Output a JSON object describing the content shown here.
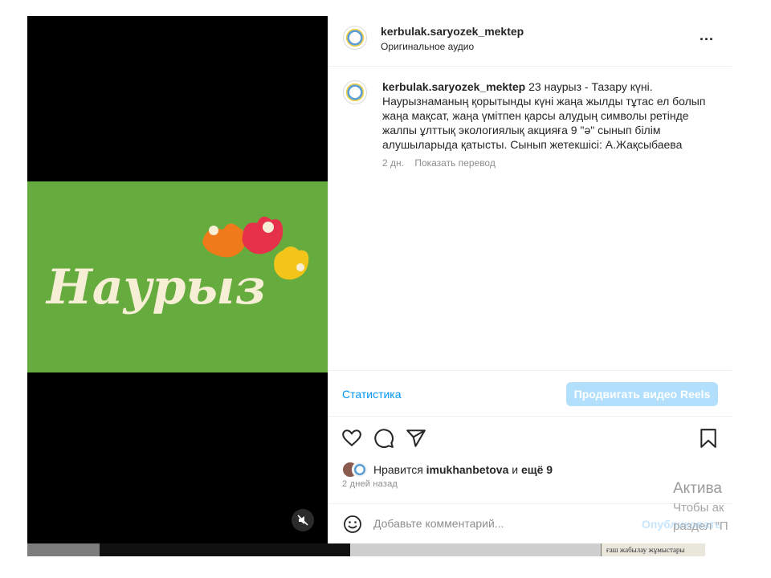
{
  "post": {
    "username": "kerbulak.saryozek_mektep",
    "audio_label": "Оригинальное аудио",
    "more_label": "...",
    "caption_user": "kerbulak.saryozek_mektep",
    "caption_text": "23 наурыз - Тазару күні. Наурызнаманың қорытынды күні жаңа жылды тұтас ел болып жаңа мақсат, жаңа үмітпен қарсы алудың символы ретінде жалпы ұлттық экологиялық акцияға 9 \"ә\" сынып білім алушыларыда қатысты. Сынып жетекшісі: А.Жақсыбаева",
    "caption_age": "2 дн.",
    "translate_label": "Показать перевод"
  },
  "video": {
    "banner_text": "Наурыз",
    "banner_color": "#66ab3e",
    "mute_icon": "speaker-muted-icon"
  },
  "insights": {
    "stats_label": "Статистика",
    "promote_label": "Продвигать видео Reels"
  },
  "actions": {
    "like_icon": "heart-icon",
    "comment_icon": "comment-icon",
    "share_icon": "send-icon",
    "save_icon": "bookmark-icon"
  },
  "likes": {
    "prefix": "Нравится",
    "user": "imukhanbetova",
    "middle": "и",
    "rest": "ещё 9",
    "time_ago": "2 дней назад"
  },
  "comment": {
    "placeholder": "Добавьте комментарий...",
    "publish_label": "Опубликовать"
  },
  "watermark": {
    "line1": "Актива",
    "line2": "Чтобы ак",
    "line3": "раздел \"П"
  },
  "background": {
    "doc_snippet": "ғаш жабылау жұмыстары"
  },
  "colors": {
    "accent": "#0095f6",
    "promote_bg": "#b2dffc",
    "publish_disabled": "#c7e6fd"
  }
}
